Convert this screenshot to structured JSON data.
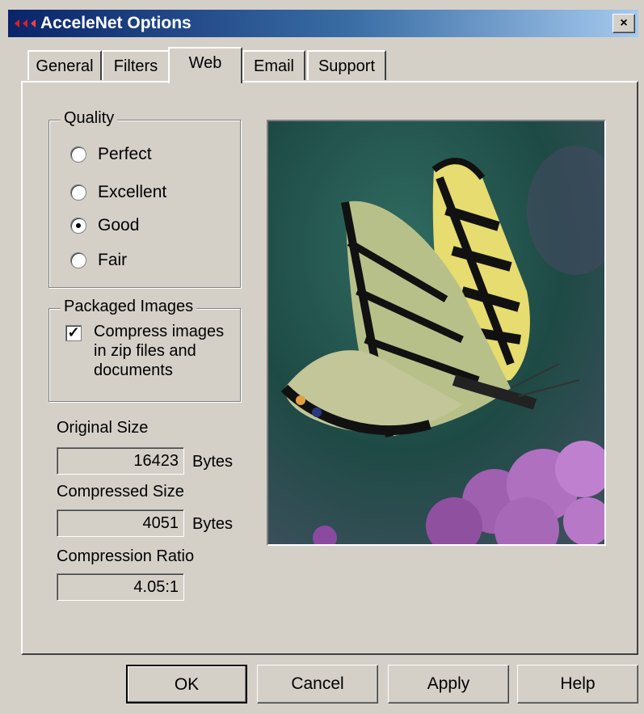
{
  "window": {
    "title": "AcceleNet Options"
  },
  "tabs": [
    {
      "label": "General",
      "active": false
    },
    {
      "label": "Filters",
      "active": false
    },
    {
      "label": "Web",
      "active": true
    },
    {
      "label": "Email",
      "active": false
    },
    {
      "label": "Support",
      "active": false
    }
  ],
  "quality": {
    "legend": "Quality",
    "options": [
      {
        "label": "Perfect",
        "selected": false
      },
      {
        "label": "Excellent",
        "selected": false
      },
      {
        "label": "Good",
        "selected": true
      },
      {
        "label": "Fair",
        "selected": false
      }
    ]
  },
  "packaged_images": {
    "legend": "Packaged Images",
    "checkbox_label": "Compress images in zip files and documents",
    "checked": true,
    "check_mark": "✓"
  },
  "stats": {
    "original_label": "Original Size",
    "original_value": "16423",
    "compressed_label": "Compressed Size",
    "compressed_value": "4051",
    "ratio_label": "Compression Ratio",
    "ratio_value": "4.05:1",
    "unit": "Bytes"
  },
  "preview": {
    "icon": "butterfly-image"
  },
  "buttons": {
    "ok": "OK",
    "cancel": "Cancel",
    "apply": "Apply",
    "help": "Help"
  },
  "title_close": "×"
}
